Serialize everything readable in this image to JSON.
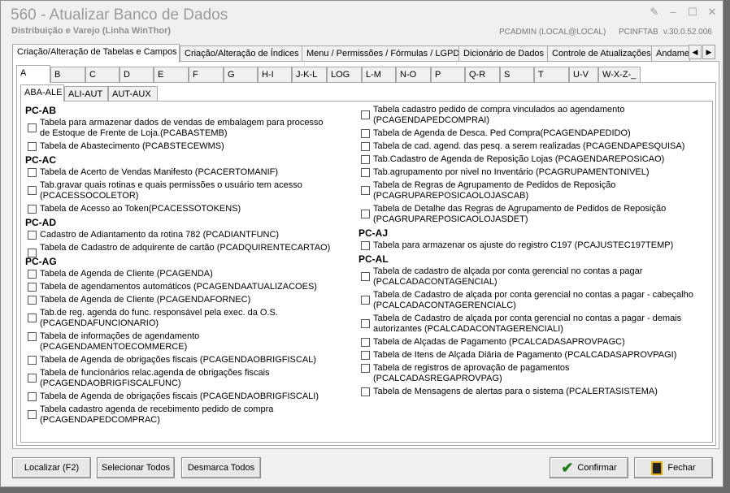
{
  "window": {
    "title": "560 - Atualizar Banco de Dados",
    "subtitle": "Distribuição e Varejo (Linha WinThor)",
    "user_info": "PCADMIN (LOCAL@LOCAL)",
    "table": "PCINFTAB",
    "version": "v.30.0.52.006"
  },
  "main_tabs": [
    "Criação/Alteração de Tabelas e Campos",
    "Criação/Alteração de Índices",
    "Menu / Permissões / Fórmulas / LGPD",
    "Dicionário de Dados",
    "Controle de Atualizações",
    "Andame"
  ],
  "letter_tabs": [
    "A",
    "B",
    "C",
    "D",
    "E",
    "F",
    "G",
    "H-I",
    "J-K-L",
    "LOG",
    "L-M",
    "N-O",
    "P",
    "Q-R",
    "S",
    "T",
    "U-V",
    "W-X-Z-_"
  ],
  "sub_tabs": [
    "ABA-ALE",
    "ALI-AUT",
    "AUT-AUX"
  ],
  "left_column": [
    {
      "group": "PC-AB"
    },
    {
      "item": "Tabela para armazenar dados de vendas de embalagem para processo de Estoque de Frente de Loja.(PCABASTEMB)"
    },
    {
      "item": "Tabela de Abastecimento (PCABSTECEWMS)"
    },
    {
      "group": "PC-AC"
    },
    {
      "item": "Tabela de Acerto de Vendas Manifesto (PCACERTOMANIF)"
    },
    {
      "item": "Tab.gravar quais rotinas e quais permissões o usuário tem acesso (PCACESSOCOLETOR)"
    },
    {
      "item": "Tabela de Acesso ao Token(PCACESSOTOKENS)"
    },
    {
      "group": "PC-AD"
    },
    {
      "item": "Cadastro de Adiantamento da rotina 782 (PCADIANTFUNC)"
    },
    {
      "item": "Tabela de Cadastro de adquirente de cartão (PCADQUIRENTECARTAO)"
    },
    {
      "group": "PC-AG"
    },
    {
      "item": "Tabela  de Agenda de Cliente (PCAGENDA)"
    },
    {
      "item": "Tabela de agendamentos automáticos (PCAGENDAATUALIZACOES)"
    },
    {
      "item": "Tabela  de Agenda de Cliente (PCAGENDAFORNEC)"
    },
    {
      "item": "Tab.de reg. agenda do func. responsável pela exec. da O.S. (PCAGENDAFUNCIONARIO)"
    },
    {
      "item": "Tabela de informações de agendamento (PCAGENDAMENTOECOMMERCE)"
    },
    {
      "item": "Tabela de Agenda de obrigações fiscais (PCAGENDAOBRIGFISCAL)"
    },
    {
      "item": "Tabela de funcionários relac.agenda de obrigações fiscais (PCAGENDAOBRIGFISCALFUNC)"
    },
    {
      "item": "Tabela de Agenda de obrigações fiscais (PCAGENDAOBRIGFISCALI)"
    },
    {
      "item": "Tabela cadastro agenda de recebimento pedido de compra (PCAGENDAPEDCOMPRAC)"
    }
  ],
  "right_column": [
    {
      "item": "Tabela cadastro pedido de compra vinculados ao agendamento (PCAGENDAPEDCOMPRAI)"
    },
    {
      "item": "Tabela  de Agenda de Desca. Ped Compra(PCAGENDAPEDIDO)"
    },
    {
      "item": "Tabela de cad. agend. das pesq. a serem realizadas (PCAGENDAPESQUISA)"
    },
    {
      "item": "Tab.Cadastro de Agenda de Reposição Lojas (PCAGENDAREPOSICAO)"
    },
    {
      "item": "Tab.agrupamento por nivel no Inventário (PCAGRUPAMENTONIVEL)"
    },
    {
      "item": "Tabela de Regras de Agrupamento de Pedidos de Reposição (PCAGRUPAREPOSICAOLOJASCAB)"
    },
    {
      "item": "Tabela de Detalhe das Regras de Agrupamento de Pedidos de Reposição (PCAGRUPAREPOSICAOLOJASDET)"
    },
    {
      "group": "PC-AJ"
    },
    {
      "item": "Tabela para armazenar os ajuste do registro C197 (PCAJUSTEC197TEMP)"
    },
    {
      "group": "PC-AL"
    },
    {
      "item": "Tabela de cadastro de alçada por conta gerencial no contas a pagar (PCALCADACONTAGENCIAL)"
    },
    {
      "item": "Tabela de Cadastro de alçada por conta gerencial no contas a pagar - cabeçalho (PCALCADACONTAGERENCIALC)"
    },
    {
      "item": "Tabela de Cadastro de alçada por conta gerencial no contas a pagar - demais autorizantes (PCALCADACONTAGERENCIALI)"
    },
    {
      "item": "Tabela de Alçadas de Pagamento (PCALCADASAPROVPAGC)"
    },
    {
      "item": "Tabela de Itens de Alçada Diária de Pagamento (PCALCADASAPROVPAGI)"
    },
    {
      "item": "Tabela de registros de aprovação de pagamentos (PCALCADASREGAPROVPAG)"
    },
    {
      "item": "Tabela de Mensagens de alertas para o sistema (PCALERTASISTEMA)"
    }
  ],
  "buttons": {
    "locate": "Localizar (F2)",
    "select_all": "Selecionar Todos",
    "unselect_all": "Desmarca Todos",
    "confirm": "Confirmar",
    "close": "Fechar"
  }
}
